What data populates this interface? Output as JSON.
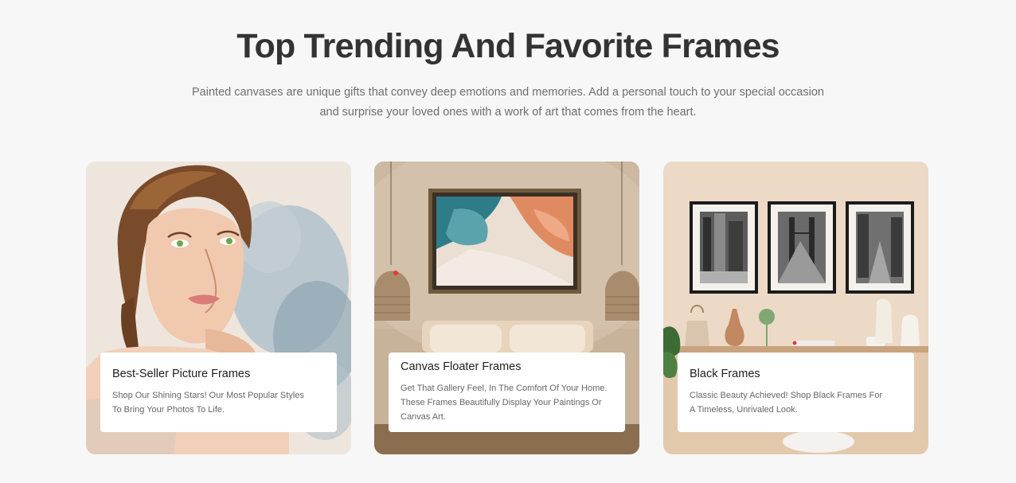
{
  "section": {
    "heading": "Top Trending And Favorite Frames",
    "subtitle_lines": [
      "Painted canvases are unique gifts that convey deep emotions and memories. Add a personal touch to your special occasion",
      "and surprise your loved ones with a work of art that comes from the heart."
    ]
  },
  "cards": [
    {
      "title": "Best-Seller Picture Frames",
      "description_lines": [
        "Shop Our Shining Stars! Our Most Popular Styles",
        "To Bring Your Photos To Life."
      ],
      "image": "watercolor-portrait"
    },
    {
      "title": "Canvas Floater Frames",
      "description_lines": [
        "Get That Gallery Feel, In The Comfort Of Your Home.",
        "These Frames Beautifully Display Your Paintings Or",
        "Canvas Art."
      ],
      "image": "abstract-painting-bedroom"
    },
    {
      "title": "Black Frames",
      "description_lines": [
        "Classic Beauty Achieved! Shop Black Frames For",
        "A Timeless, Unrivaled Look."
      ],
      "image": "black-frames-city-photos"
    }
  ],
  "colors": {
    "background": "#f7f7f7",
    "heading": "#333333",
    "subtitle": "#6f6f6f",
    "caption_bg": "#ffffff"
  }
}
